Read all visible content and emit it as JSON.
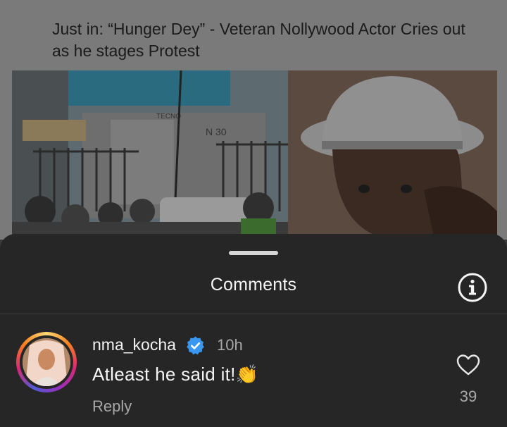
{
  "post": {
    "title": "Just in: “Hunger Dey” - Veteran Nollywood Actor Cries out as he stages Protest",
    "image_sign_text": "N 30",
    "image_brand_text": "TECNO"
  },
  "sheet": {
    "title": "Comments",
    "info_icon": "info-icon"
  },
  "comment": {
    "username": "nma_kocha",
    "verified_icon": "verified-badge-icon",
    "timestamp": "10h",
    "text": "Atleast he said it!👏",
    "reply_label": "Reply",
    "like_icon": "heart-icon",
    "like_count": "39"
  },
  "colors": {
    "sheet_bg": "#262626",
    "verified_blue": "#3897f0",
    "muted_text": "#a8a8a8"
  }
}
